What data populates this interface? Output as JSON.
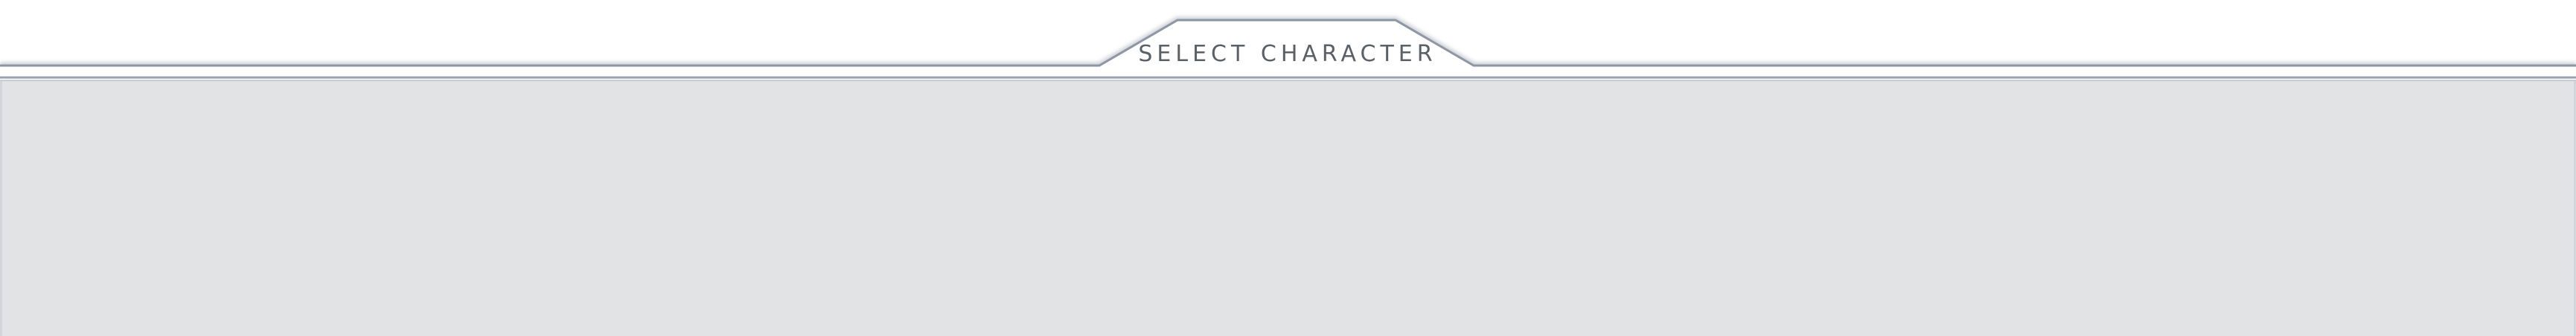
{
  "screen": {
    "tab_title": "SELECT CHARACTER"
  },
  "colors": {
    "frame_fill": "#ffffff",
    "frame_stroke": "#8e95a3",
    "panel_background": "#e1e3e5",
    "title_text": "#5b5f66"
  }
}
